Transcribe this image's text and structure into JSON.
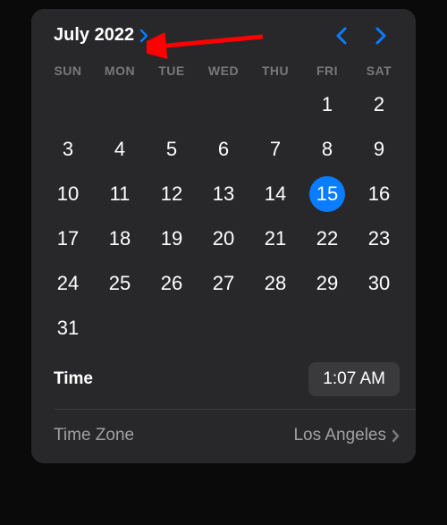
{
  "header": {
    "month_year": "July 2022"
  },
  "weekdays": [
    "SUN",
    "MON",
    "TUE",
    "WED",
    "THU",
    "FRI",
    "SAT"
  ],
  "calendar": {
    "leading_blanks": 5,
    "days_in_month": 31,
    "selected_day": 15
  },
  "time": {
    "label": "Time",
    "value": "1:07 AM"
  },
  "timezone": {
    "label": "Time Zone",
    "value": "Los Angeles"
  },
  "colors": {
    "accent": "#0a7cff"
  }
}
